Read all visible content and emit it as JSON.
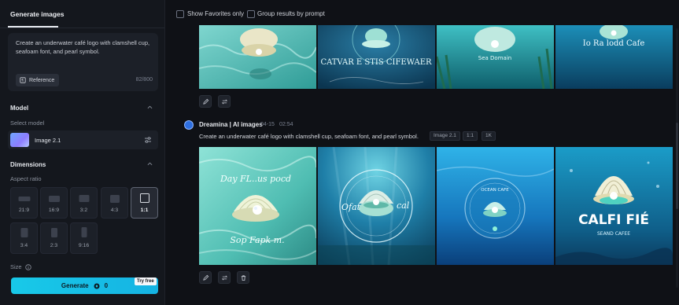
{
  "left_panel": {
    "tab_title": "Generate images",
    "prompt": "Create an underwater café logo with clamshell cup, seafoam font, and pearl symbol.",
    "reference_label": "Reference",
    "char_count": "82/800",
    "model_section": "Model",
    "select_model_label": "Select model",
    "model_name": "Image 2.1",
    "dimensions_section": "Dimensions",
    "aspect_ratio_label": "Aspect ratio",
    "ratios": [
      "21:9",
      "16:9",
      "3:2",
      "4:3",
      "1:1",
      "3:4",
      "2:3",
      "9:16"
    ],
    "selected_ratio": "1:1",
    "size_label": "Size",
    "generate_label": "Generate",
    "generate_cost": "0",
    "try_free": "Try free"
  },
  "topbar": {
    "show_favorites": "Show Favorites only",
    "group_results": "Group results by prompt"
  },
  "previous_result": {
    "image_texts": [
      "",
      "CATVAR E STIS CIFEWAER",
      "Sea Domain",
      "Io Ra lodd Cafe"
    ]
  },
  "generation": {
    "author": "Dreamina | AI images",
    "date": "04-15",
    "time": "02:54",
    "prompt": "Create an underwater café logo with clamshell cup, seafoam font, and pearl symbol.",
    "tags": [
      "Image 2.1",
      "1:1",
      "1K"
    ],
    "image_texts": [
      {
        "top": "Day FL..us pocd",
        "bottom": "Sop Fapk m."
      },
      {
        "left": "Ofat",
        "right": "cal"
      },
      {
        "ring": "OCEAN CAFE"
      },
      {
        "title": "CALFI FIÉ",
        "subtitle": "SEAND CAFEE"
      }
    ]
  },
  "colors": {
    "accent": "#17c3e6",
    "panel": "#14171d",
    "background": "#0f1116"
  }
}
